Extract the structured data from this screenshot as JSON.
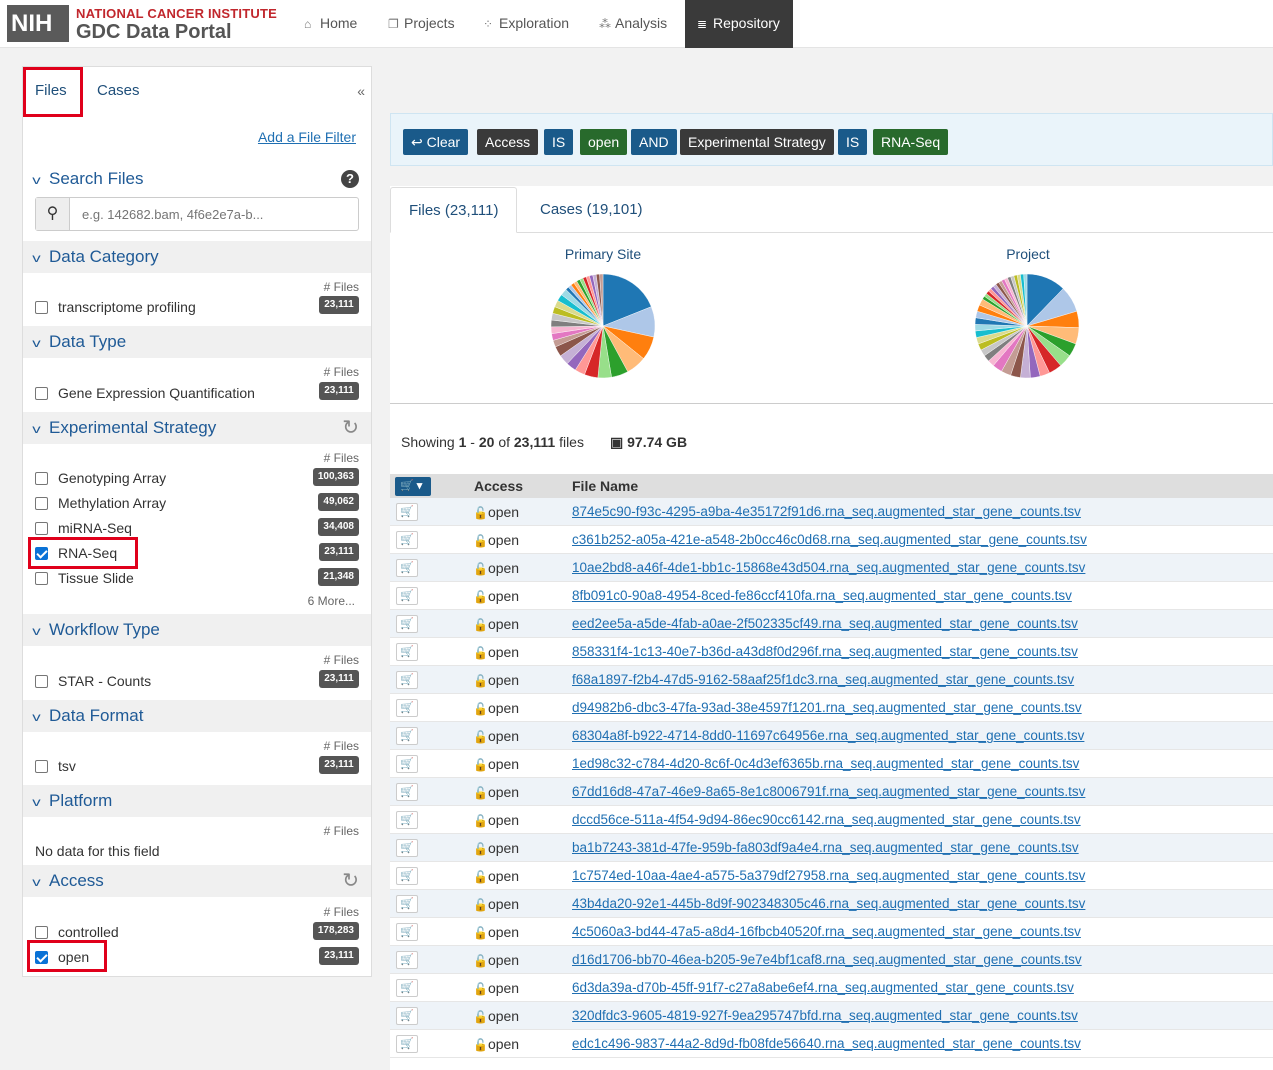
{
  "header": {
    "logo": "NIH",
    "institute": "NATIONAL CANCER INSTITUTE",
    "portal": "GDC Data Portal",
    "nav": [
      {
        "label": "Home",
        "icon": "home-icon",
        "active": false
      },
      {
        "label": "Projects",
        "icon": "projects-icon",
        "active": false
      },
      {
        "label": "Exploration",
        "icon": "exploration-icon",
        "active": false
      },
      {
        "label": "Analysis",
        "icon": "analysis-icon",
        "active": false
      },
      {
        "label": "Repository",
        "icon": "database-icon",
        "active": true
      }
    ]
  },
  "sidebar": {
    "tabs": {
      "files": "Files",
      "cases": "Cases"
    },
    "collapse": "«",
    "add_filter": "Add a File Filter",
    "search": {
      "title": "Search Files",
      "placeholder": "e.g. 142682.bam, 4f6e2e7a-b..."
    },
    "files_header": "# Files",
    "facets": {
      "data_category": {
        "title": "Data Category",
        "options": [
          {
            "label": "transcriptome profiling",
            "count": "23,111",
            "checked": false
          }
        ]
      },
      "data_type": {
        "title": "Data Type",
        "options": [
          {
            "label": "Gene Expression Quantification",
            "count": "23,111",
            "checked": false
          }
        ]
      },
      "experimental_strategy": {
        "title": "Experimental Strategy",
        "options": [
          {
            "label": "Genotyping Array",
            "count": "100,363",
            "checked": false
          },
          {
            "label": "Methylation Array",
            "count": "49,062",
            "checked": false
          },
          {
            "label": "miRNA-Seq",
            "count": "34,408",
            "checked": false
          },
          {
            "label": "RNA-Seq",
            "count": "23,111",
            "checked": true
          },
          {
            "label": "Tissue Slide",
            "count": "21,348",
            "checked": false
          }
        ],
        "more": "6 More..."
      },
      "workflow_type": {
        "title": "Workflow Type",
        "options": [
          {
            "label": "STAR - Counts",
            "count": "23,111",
            "checked": false
          }
        ]
      },
      "data_format": {
        "title": "Data Format",
        "options": [
          {
            "label": "tsv",
            "count": "23,111",
            "checked": false
          }
        ]
      },
      "platform": {
        "title": "Platform",
        "no_data": "No data for this field"
      },
      "access": {
        "title": "Access",
        "options": [
          {
            "label": "controlled",
            "count": "178,283",
            "checked": false
          },
          {
            "label": "open",
            "count": "23,111",
            "checked": true
          }
        ]
      }
    }
  },
  "query": {
    "clear": "Clear",
    "pills": [
      {
        "text": "Access",
        "style": "dark"
      },
      {
        "text": "IS",
        "style": "blue"
      },
      {
        "text": "open",
        "style": "green"
      },
      {
        "text": "AND",
        "style": "blue"
      },
      {
        "text": "Experimental Strategy",
        "style": "dark"
      },
      {
        "text": "IS",
        "style": "blue"
      },
      {
        "text": "RNA-Seq",
        "style": "green"
      }
    ]
  },
  "main": {
    "tabs": {
      "files": "Files (23,111)",
      "cases": "Cases (19,101)"
    },
    "charts": {
      "primary_site": "Primary Site",
      "project": "Project"
    },
    "showing": {
      "prefix": "Showing",
      "from": "1",
      "dash": "-",
      "to": "20",
      "of": "of",
      "total": "23,111",
      "suffix": "files"
    },
    "size": "97.74 GB",
    "table": {
      "headers": {
        "access": "Access",
        "file_name": "File Name"
      },
      "access_value": "open",
      "rows": [
        "874e5c90-f93c-4295-a9ba-4e35172f91d6.rna_seq.augmented_star_gene_counts.tsv",
        "c361b252-a05a-421e-a548-2b0cc46c0d68.rna_seq.augmented_star_gene_counts.tsv",
        "10ae2bd8-a46f-4de1-bb1c-15868e43d504.rna_seq.augmented_star_gene_counts.tsv",
        "8fb091c0-90a8-4954-8ced-fe86ccf410fa.rna_seq.augmented_star_gene_counts.tsv",
        "eed2ee5a-a5de-4fab-a0ae-2f502335cf49.rna_seq.augmented_star_gene_counts.tsv",
        "858331f4-1c13-40e7-b36d-a43d8f0d296f.rna_seq.augmented_star_gene_counts.tsv",
        "f68a1897-f2b4-47d5-9162-58aaf25f1dc3.rna_seq.augmented_star_gene_counts.tsv",
        "d94982b6-dbc3-47fa-93ad-38e4597f1201.rna_seq.augmented_star_gene_counts.tsv",
        "68304a8f-b922-4714-8dd0-11697c64956e.rna_seq.augmented_star_gene_counts.tsv",
        "1ed98c32-c784-4d20-8c6f-0c4d3ef6365b.rna_seq.augmented_star_gene_counts.tsv",
        "67dd16d8-47a7-46e9-8a65-8e1c8006791f.rna_seq.augmented_star_gene_counts.tsv",
        "dccd56ce-511a-4f54-9d94-86ec90cc6142.rna_seq.augmented_star_gene_counts.tsv",
        "ba1b7243-381d-47fe-959b-fa803df9a4e4.rna_seq.augmented_star_gene_counts.tsv",
        "1c7574ed-10aa-4ae4-a575-5a379df27958.rna_seq.augmented_star_gene_counts.tsv",
        "43b4da20-92e1-445b-8d9f-902348305c46.rna_seq.augmented_star_gene_counts.tsv",
        "4c5060a3-bd44-47a5-a8d4-16fbcb40520f.rna_seq.augmented_star_gene_counts.tsv",
        "d16d1706-bb70-46ea-b205-9e7e4bf1caf8.rna_seq.augmented_star_gene_counts.tsv",
        "6d3da39a-d70b-45ff-91f7-c27a8abe6ef4.rna_seq.augmented_star_gene_counts.tsv",
        "320dfdc3-9605-4819-927f-9ea295747bfd.rna_seq.augmented_star_gene_counts.tsv",
        "edc1c496-9837-44a2-8d9d-fb08fde56640.rna_seq.augmented_star_gene_counts.tsv"
      ]
    }
  },
  "colors": {
    "pie_palette": [
      "#1f77b4",
      "#aec7e8",
      "#ff7f0e",
      "#ffbb78",
      "#2ca02c",
      "#98df8a",
      "#d62728",
      "#ff9896",
      "#9467bd",
      "#c5b0d5",
      "#8c564b",
      "#c49c94",
      "#e377c2",
      "#f7b6d2",
      "#7f7f7f",
      "#c7c7c7",
      "#bcbd22",
      "#dbdb8d",
      "#17becf",
      "#9edae5"
    ]
  }
}
